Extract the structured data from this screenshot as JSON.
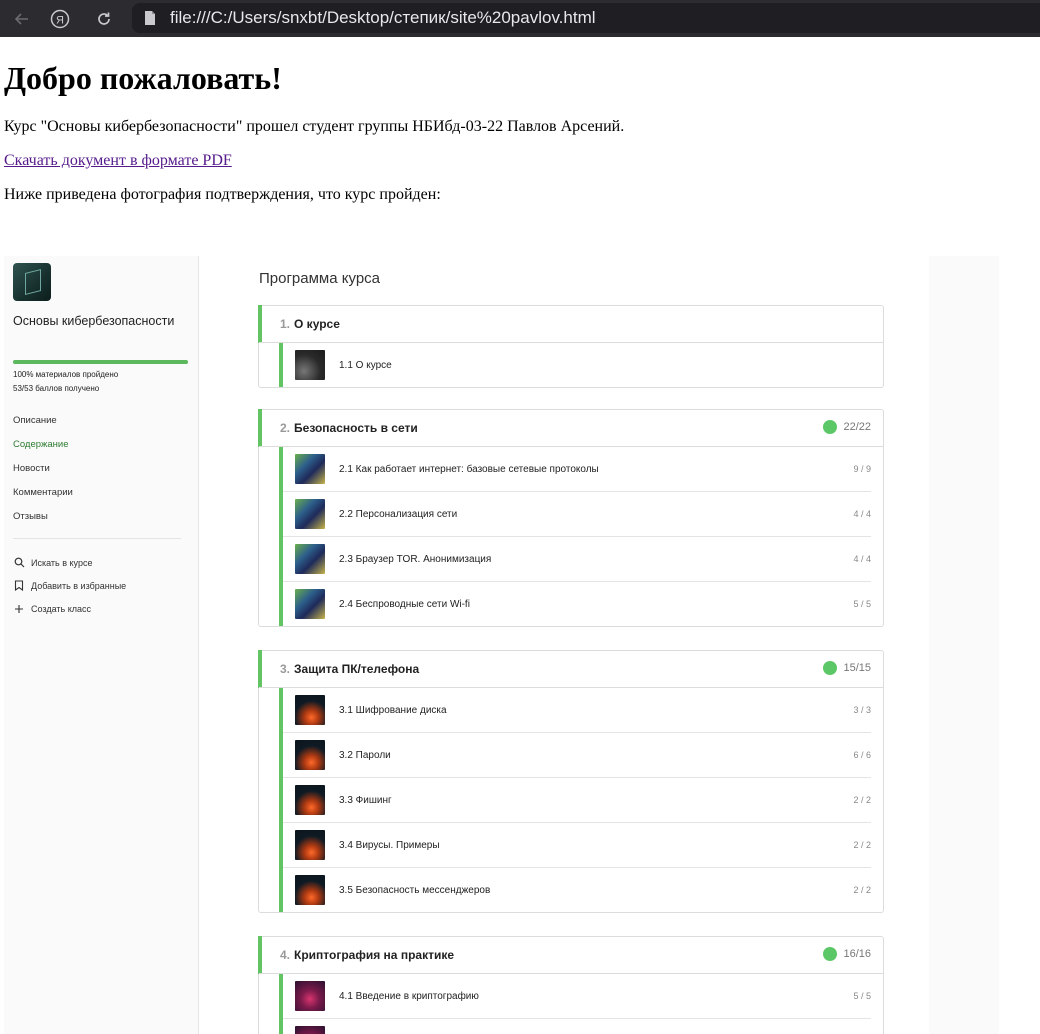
{
  "browser": {
    "url": "file:///C:/Users/snxbt/Desktop/степик/site%20pavlov.html"
  },
  "page": {
    "heading": "Добро пожаловать!",
    "intro": "Курс \"Основы кибербезопасности\" прошел студент группы НБИбд-03-22 Павлов Арсений.",
    "pdf_link": "Скачать документ в формате PDF",
    "photo_caption": "Ниже приведена фотография подтверждения, что курс пройден:"
  },
  "course": {
    "title": "Основы кибербезопасности",
    "progress_fraction": 1.0,
    "materials_text": "100% материалов пройдено",
    "points_text": "53/53 баллов получено",
    "menu": [
      "Описание",
      "Содержание",
      "Новости",
      "Комментарии",
      "Отзывы"
    ],
    "active_menu": "Содержание",
    "actions": [
      "Искать в курсе",
      "Добавить в избранные",
      "Создать класс"
    ],
    "program_title": "Программа курса",
    "sections": [
      {
        "num": "1.",
        "title": "О курсе",
        "score": "",
        "lessons": [
          {
            "title": "1.1 О курсе",
            "score": ""
          }
        ]
      },
      {
        "num": "2.",
        "title": "Безопасность в сети",
        "score": "22/22",
        "lessons": [
          {
            "title": "2.1 Как работает интернет: базовые сетевые протоколы",
            "score": "9 / 9"
          },
          {
            "title": "2.2 Персонализация сети",
            "score": "4 / 4"
          },
          {
            "title": "2.3 Браузер TOR. Анонимизация",
            "score": "4 / 4"
          },
          {
            "title": "2.4 Беспроводные сети Wi-fi",
            "score": "5 / 5"
          }
        ]
      },
      {
        "num": "3.",
        "title": "Защита ПК/телефона",
        "score": "15/15",
        "lessons": [
          {
            "title": "3.1 Шифрование диска",
            "score": "3 / 3"
          },
          {
            "title": "3.2 Пароли",
            "score": "6 / 6"
          },
          {
            "title": "3.3 Фишинг",
            "score": "2 / 2"
          },
          {
            "title": "3.4 Вирусы. Примеры",
            "score": "2 / 2"
          },
          {
            "title": "3.5 Безопасность мессенджеров",
            "score": "2 / 2"
          }
        ]
      },
      {
        "num": "4.",
        "title": "Криптография на практике",
        "score": "16/16",
        "lessons": [
          {
            "title": "4.1 Введение в криптографию",
            "score": "5 / 5"
          },
          {
            "title": "",
            "score": ""
          }
        ]
      }
    ]
  }
}
